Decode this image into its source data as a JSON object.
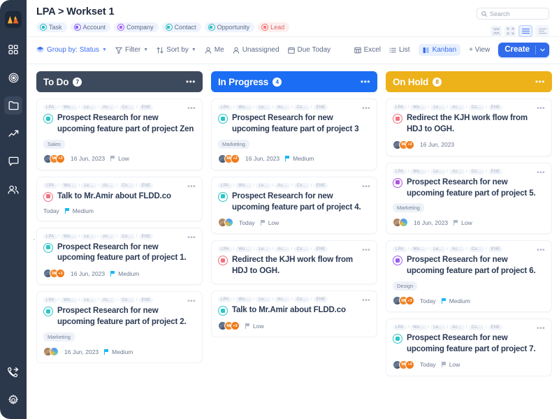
{
  "sidebar": {
    "logo_name": "mountains-logo",
    "items": [
      {
        "name": "sidebar-item-dashboard",
        "icon": "grid-icon",
        "active": false
      },
      {
        "name": "sidebar-item-goals",
        "icon": "target-icon",
        "active": false
      },
      {
        "name": "sidebar-item-files",
        "icon": "folder-icon",
        "active": true
      },
      {
        "name": "sidebar-item-analytics",
        "icon": "trending-up-icon",
        "active": false
      },
      {
        "name": "sidebar-item-messages",
        "icon": "chat-icon",
        "active": false
      },
      {
        "name": "sidebar-item-contacts",
        "icon": "users-icon",
        "active": false
      }
    ],
    "bottom_items": [
      {
        "name": "sidebar-item-calls",
        "icon": "phone-forward-icon"
      },
      {
        "name": "sidebar-item-settings",
        "icon": "gear-icon"
      }
    ]
  },
  "header": {
    "title": "LPA > Workset 1",
    "chips": [
      {
        "label": "Task",
        "icon": "task-icon",
        "color": "teal"
      },
      {
        "label": "Account",
        "icon": "account-icon",
        "color": "purple"
      },
      {
        "label": "Company",
        "icon": "company-icon",
        "color": "magenta"
      },
      {
        "label": "Contact",
        "icon": "contact-icon",
        "color": "teal"
      },
      {
        "label": "Opportunity",
        "icon": "opportunity-icon",
        "color": "teal"
      },
      {
        "label": "Lead",
        "icon": "lead-icon",
        "color": "red"
      }
    ]
  },
  "search": {
    "placeholder": "Search",
    "value": "",
    "icon": "search-icon"
  },
  "view_toggles": [
    {
      "name": "collapse-view-button",
      "icon": "collapse-arrows-icon",
      "active": false
    },
    {
      "name": "expand-view-button",
      "icon": "expand-arrows-icon",
      "active": false
    },
    {
      "name": "comfortable-density-button",
      "icon": "rows-dense-icon",
      "active": true
    },
    {
      "name": "compact-density-button",
      "icon": "rows-compact-icon",
      "active": false
    }
  ],
  "toolbar": {
    "group_by": "Group by: Status",
    "filter": "Filter",
    "sort_by": "Sort by",
    "me": "Me",
    "unassigned": "Unassigned",
    "due_today": "Due Today",
    "excel": "Excel",
    "list": "List",
    "kanban": "Kanban",
    "add_view": "+ View",
    "create": "Create",
    "create_caret": "⌄"
  },
  "colors": {
    "todo_header": "#3d4a5e",
    "inprogress_header": "#1b6ef3",
    "onhold_header": "#edb11a",
    "accent": "#2f6bea",
    "sidebar": "#2b374b"
  },
  "crumbs": [
    "LPA",
    "Wo…",
    "Le…",
    "Ac…",
    "Co…",
    "ENE"
  ],
  "board": {
    "columns": [
      {
        "title": "To Do",
        "count": "7",
        "header_color": "#3d4a5e",
        "count_text_color": "#3d4a5e",
        "cards": [
          {
            "title": "Prospect Research for new upcoming feature part of project Zen",
            "type": "contact",
            "tag": "Sales",
            "date": "16 Jun, 2023",
            "priority": "Low",
            "priority_level": "low",
            "avatars": [
              "photo",
              "MI",
              "+3"
            ]
          },
          {
            "title": "Talk to Mr.Amir about FLDD.co",
            "type": "lead",
            "tag": "",
            "date": "Today",
            "priority": "Medium",
            "priority_level": "medium",
            "avatars": []
          },
          {
            "title": "Prospect Research for new upcoming feature part of project 1.",
            "type": "contact",
            "tag": "",
            "date": "16 Jun, 2023",
            "priority": "Medium",
            "priority_level": "medium",
            "avatars": [
              "photo",
              "MI",
              "+3"
            ]
          },
          {
            "title": "Prospect Research for new upcoming feature part of project 2.",
            "type": "contact",
            "tag": "Marketing",
            "date": "16 Jun, 2023",
            "priority": "Medium",
            "priority_level": "medium",
            "avatars": [
              "photo2",
              "ring"
            ]
          }
        ]
      },
      {
        "title": "In Progress",
        "count": "4",
        "header_color": "#1b6ef3",
        "count_text_color": "#1b6ef3",
        "cards": [
          {
            "title": "Prospect Research for new upcoming feature part of project 3",
            "type": "contact",
            "tag": "Marketing",
            "date": "16 Jun, 2023",
            "priority": "Medium",
            "priority_level": "medium",
            "avatars": [
              "photo",
              "MI",
              "+3"
            ]
          },
          {
            "title": "Prospect Research for new upcoming feature part of project 4.",
            "type": "contact",
            "tag": "",
            "date": "Today",
            "priority": "Low",
            "priority_level": "low",
            "avatars": [
              "photo2",
              "ring"
            ]
          },
          {
            "title": "Redirect the KJH work flow from HDJ to OGH.",
            "type": "lead",
            "tag": "",
            "date": "",
            "priority": "",
            "priority_level": "",
            "avatars": []
          },
          {
            "title": "Talk to Mr.Amir about FLDD.co",
            "type": "contact",
            "tag": "",
            "date": "",
            "priority": "Low",
            "priority_level": "low",
            "avatars": [
              "photo",
              "MI",
              "+3"
            ]
          }
        ]
      },
      {
        "title": "On Hold",
        "count": "8",
        "header_color": "#edb11a",
        "count_text_color": "#c8920f",
        "cards": [
          {
            "title": "Redirect the KJH work flow from HDJ to OGH.",
            "type": "lead",
            "tag": "",
            "date": "16 Jun, 2023",
            "priority": "",
            "priority_level": "",
            "avatars": [
              "photo",
              "MI",
              "+3"
            ]
          },
          {
            "title": "Prospect Research for new upcoming feature part of project 5.",
            "type": "company",
            "tag": "Marketing",
            "date": "16 Jun, 2023",
            "priority": "Low",
            "priority_level": "low",
            "avatars": [
              "photo2",
              "ring"
            ]
          },
          {
            "title": "Prospect Research for new upcoming feature part of project 6.",
            "type": "account",
            "tag": "Design",
            "date": "Today",
            "priority": "Medium",
            "priority_level": "medium",
            "avatars": [
              "photo",
              "MI",
              "+3"
            ]
          },
          {
            "title": "Prospect Research for new upcoming feature part of project 7.",
            "type": "contact",
            "tag": "",
            "date": "Today",
            "priority": "Low",
            "priority_level": "low",
            "avatars": [
              "photo",
              "MI",
              "+3"
            ]
          }
        ]
      }
    ]
  }
}
